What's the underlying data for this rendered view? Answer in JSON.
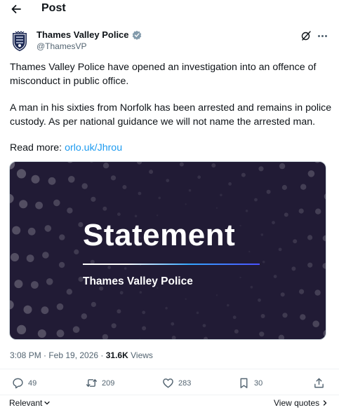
{
  "header": {
    "title": "Post"
  },
  "author": {
    "name": "Thames Valley Police",
    "handle": "@ThamesVP"
  },
  "tweet": {
    "paragraph_1": "Thames Valley Police have opened an investigation into an offence of misconduct in public office.",
    "paragraph_2": "A man in his sixties from Norfolk has been arrested and remains in police custody. As per national guidance we will not name the arrested man.",
    "read_more_label": "Read more: ",
    "link_text": "orlo.uk/Jhrou"
  },
  "media": {
    "headline": "Statement",
    "subtitle": "Thames Valley Police"
  },
  "meta": {
    "timestamp": "3:08 PM · Feb 19, 2026 · ",
    "views_count": "31.6K",
    "views_label": " Views"
  },
  "actions": {
    "replies": "49",
    "reposts": "209",
    "likes": "283",
    "bookmarks": "30"
  },
  "footer": {
    "sort_label": "Relevant",
    "view_quotes_label": "View quotes"
  },
  "icons": [
    "back-arrow-icon",
    "verified-badge-icon",
    "grok-icon",
    "more-icon",
    "reply-icon",
    "repost-icon",
    "like-icon",
    "bookmark-icon",
    "share-icon",
    "chevron-down-icon",
    "chevron-right-icon"
  ],
  "colors": {
    "link": "#1d9bf0",
    "verified": "#829aab",
    "media_bg": "#211b35",
    "secondary_text": "#536471"
  }
}
